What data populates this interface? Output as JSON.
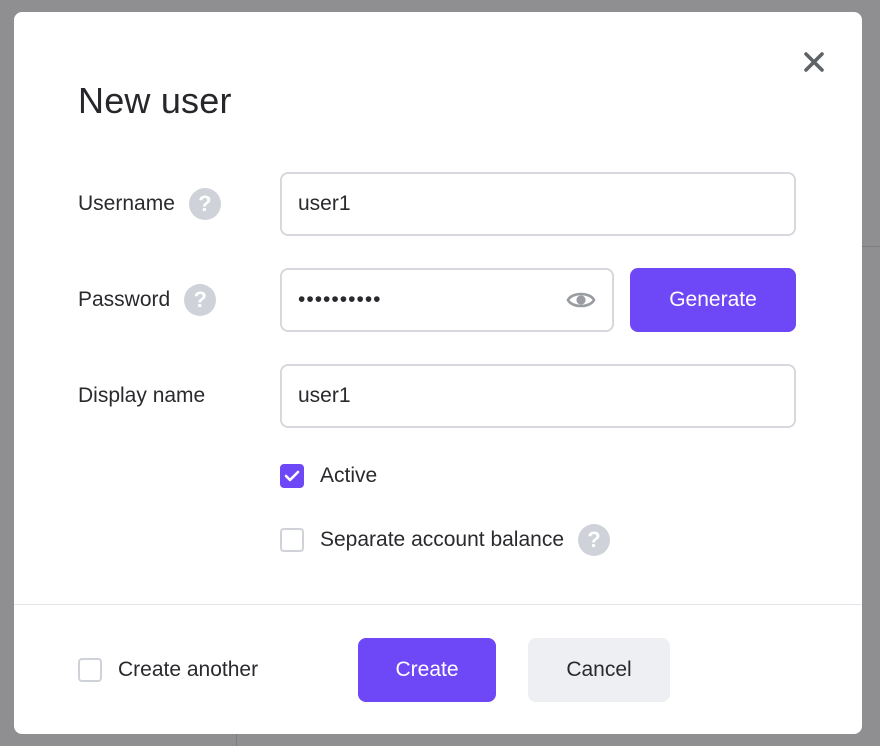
{
  "dialog": {
    "title": "New user",
    "close_icon": "close-icon"
  },
  "fields": {
    "username": {
      "label": "Username",
      "value": "user1",
      "help_icon": "help-icon"
    },
    "password": {
      "label": "Password",
      "value": "••••••••••",
      "help_icon": "help-icon",
      "toggle_icon": "eye-icon"
    },
    "display_name": {
      "label": "Display name",
      "value": "user1"
    }
  },
  "buttons": {
    "generate": "Generate",
    "create": "Create",
    "cancel": "Cancel"
  },
  "options": {
    "active": {
      "label": "Active",
      "checked": true
    },
    "separate_balance": {
      "label": "Separate account balance",
      "checked": false,
      "help_icon": "help-icon"
    },
    "create_another": {
      "label": "Create another",
      "checked": false
    }
  },
  "colors": {
    "accent": "#6e48f6",
    "help_icon": "#cfd2d8",
    "secondary_button": "#eeeff3",
    "overlay": "#8f8f92"
  }
}
